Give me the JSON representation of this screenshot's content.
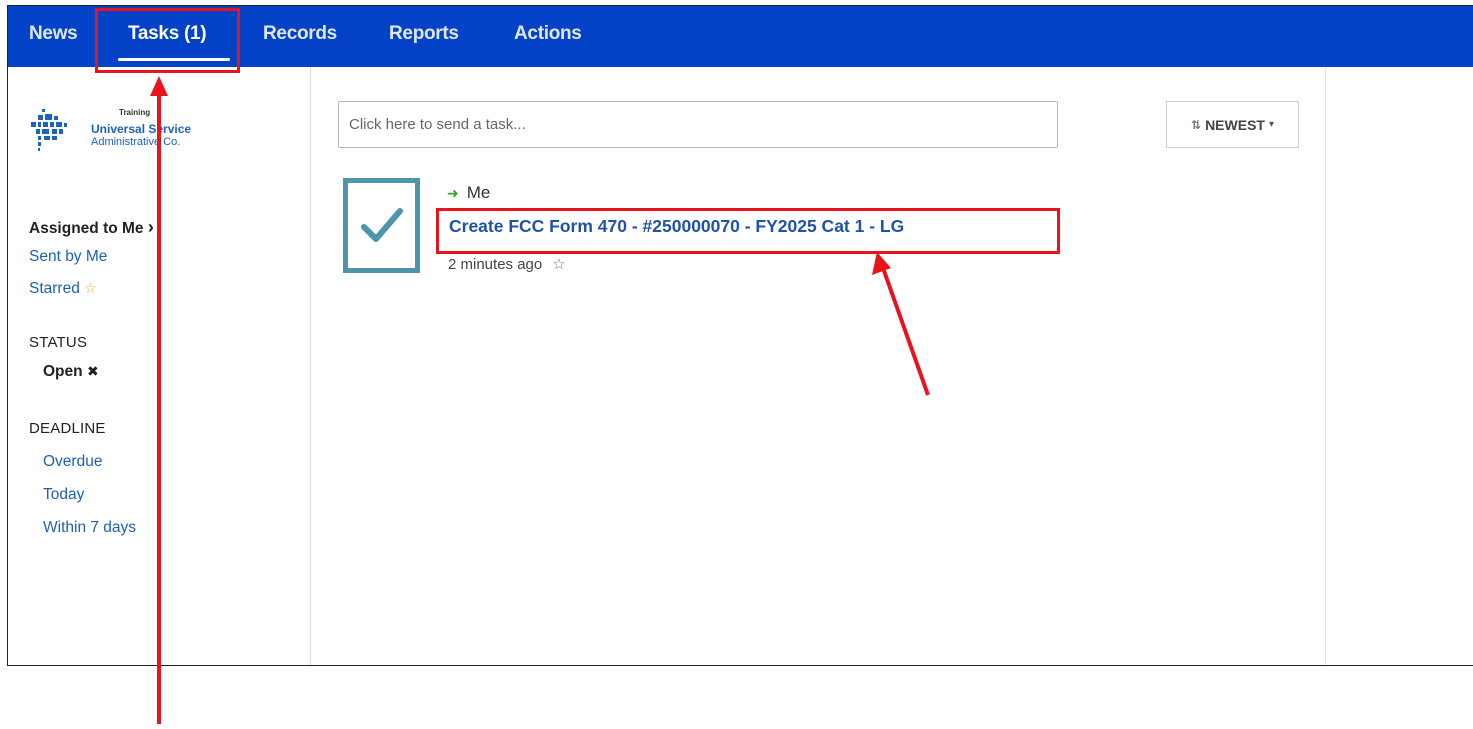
{
  "nav": {
    "news": "News",
    "tasks": "Tasks (1)",
    "records": "Records",
    "reports": "Reports",
    "actions": "Actions"
  },
  "logo": {
    "training": "Training",
    "line1": "Universal Service",
    "line2": "Administrative Co."
  },
  "sidebar": {
    "assigned": "Assigned to Me",
    "assigned_chevron": "›",
    "sent": "Sent by Me",
    "starred": "Starred",
    "status_heading": "STATUS",
    "status_open": "Open",
    "status_clear": "✖",
    "deadline_heading": "DEADLINE",
    "deadline_items": [
      "Overdue",
      "Today",
      "Within 7 days"
    ]
  },
  "search": {
    "placeholder": "Click here to send a task..."
  },
  "sort": {
    "label": "NEWEST",
    "icon": "sort-icon"
  },
  "task": {
    "assignee": "Me",
    "title": "Create FCC Form 470 - #250000070 - FY2025 Cat 1 - LG",
    "time": "2 minutes ago"
  },
  "colors": {
    "nav_bg": "#0442c7",
    "link": "#1d5fb7",
    "title": "#1f53a8",
    "highlight": "#e8141b",
    "check_border": "#4d95ab"
  }
}
